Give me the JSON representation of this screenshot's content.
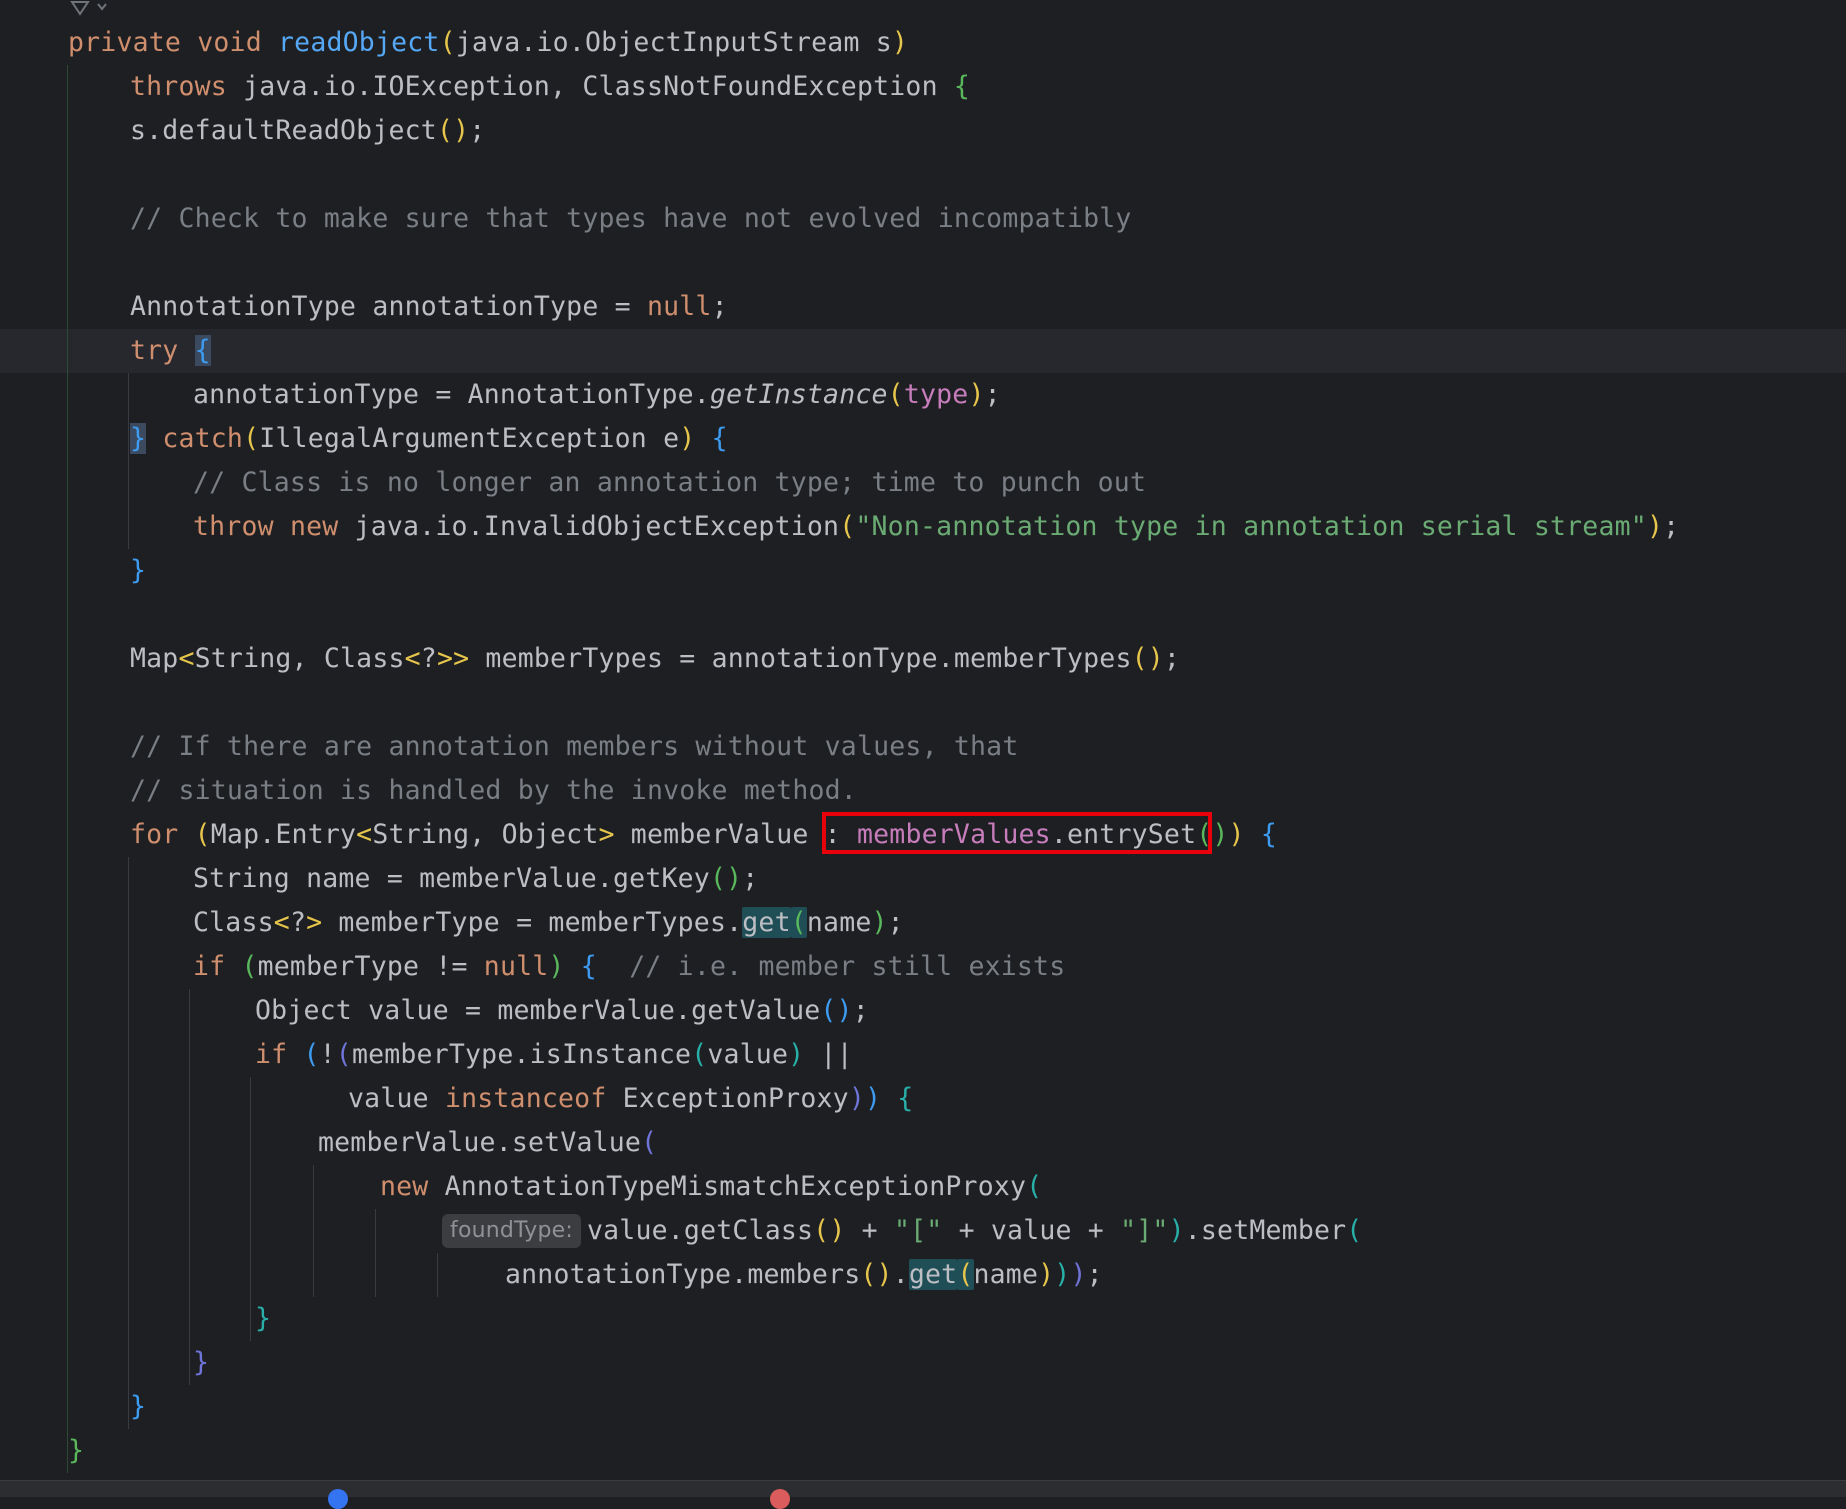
{
  "editor": {
    "lines": [
      "private void readObject(java.io.ObjectInputStream s)",
      "throws java.io.IOException, ClassNotFoundException {",
      "s.defaultReadObject();",
      "",
      "// Check to make sure that types have not evolved incompatibly",
      "",
      "AnnotationType annotationType = null;",
      "try {",
      "annotationType = AnnotationType.getInstance(type);",
      "} catch(IllegalArgumentException e) {",
      "// Class is no longer an annotation type; time to punch out",
      "throw new java.io.InvalidObjectException(\"Non-annotation type in annotation serial stream\");",
      "}",
      "",
      "Map<String, Class<?>> memberTypes = annotationType.memberTypes();",
      "",
      "// If there are annotation members without values, that",
      "// situation is handled by the invoke method.",
      "for (Map.Entry<String, Object> memberValue : memberValues.entrySet()) {",
      "String name = memberValue.getKey();",
      "Class<?> memberType = memberTypes.get(name);",
      "if (memberType != null) {  // i.e. member still exists",
      "Object value = memberValue.getValue();",
      "if (!(memberType.isInstance(value) ||",
      "value instanceof ExceptionProxy)) {",
      "memberValue.setValue(",
      "new AnnotationTypeMismatchExceptionProxy(",
      "value.getClass() + \"[\" + value + \"]\").setMember(",
      "annotationType.members().get(name)));",
      "}",
      "}",
      "}",
      "}"
    ],
    "inlay_hint": "foundType:",
    "highlighted_expression": "memberValues.entrySet()"
  }
}
